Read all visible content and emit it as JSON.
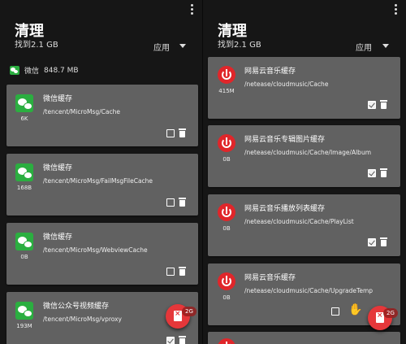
{
  "left": {
    "title": "清理",
    "found": "找到2.1 GB",
    "apply_label": "应用",
    "group_name": "微信",
    "group_size": "848.7 MB",
    "items": [
      {
        "name": "微信缓存",
        "path": "/tencent/MicroMsg/Cache",
        "size": "6K",
        "checked": false
      },
      {
        "name": "微信缓存",
        "path": "/tencent/MicroMsg/FailMsgFileCache",
        "size": "168B",
        "checked": false
      },
      {
        "name": "微信缓存",
        "path": "/tencent/MicroMsg/WebviewCache",
        "size": "0B",
        "checked": false
      },
      {
        "name": "微信公众号视频缓存",
        "path": "/tencent/MicroMsg/vproxy",
        "size": "193M",
        "checked": true
      }
    ],
    "fab_badge": "2G"
  },
  "right": {
    "title": "清理",
    "found": "找到2.1 GB",
    "apply_label": "应用",
    "items": [
      {
        "name": "网易云音乐缓存",
        "path": "/netease/cloudmusic/Cache",
        "size": "415M",
        "checked": true
      },
      {
        "name": "网易云音乐专辑图片缓存",
        "path": "/netease/cloudmusic/Cache/Image/Album",
        "size": "0B",
        "checked": true
      },
      {
        "name": "网易云音乐播放列表缓存",
        "path": "/netease/cloudmusic/Cache/PlayList",
        "size": "0B",
        "checked": true
      },
      {
        "name": "网易云音乐缓存",
        "path": "/netease/cloudmusic/Cache/UpgradeTemp",
        "size": "0B",
        "checked": false
      }
    ],
    "fab_badge": "2G"
  },
  "icons": {
    "wechat": "wechat-icon",
    "netease": "netease-music-icon",
    "trash": "trash-icon",
    "menu": "more-vert-icon",
    "hand": "hand-pointer-icon",
    "fab": "clean-icon"
  },
  "colors": {
    "card_bg": "#616161",
    "wechat_green": "#2bae40",
    "netease_red": "#e0262a",
    "fab_red": "#e5373a"
  }
}
